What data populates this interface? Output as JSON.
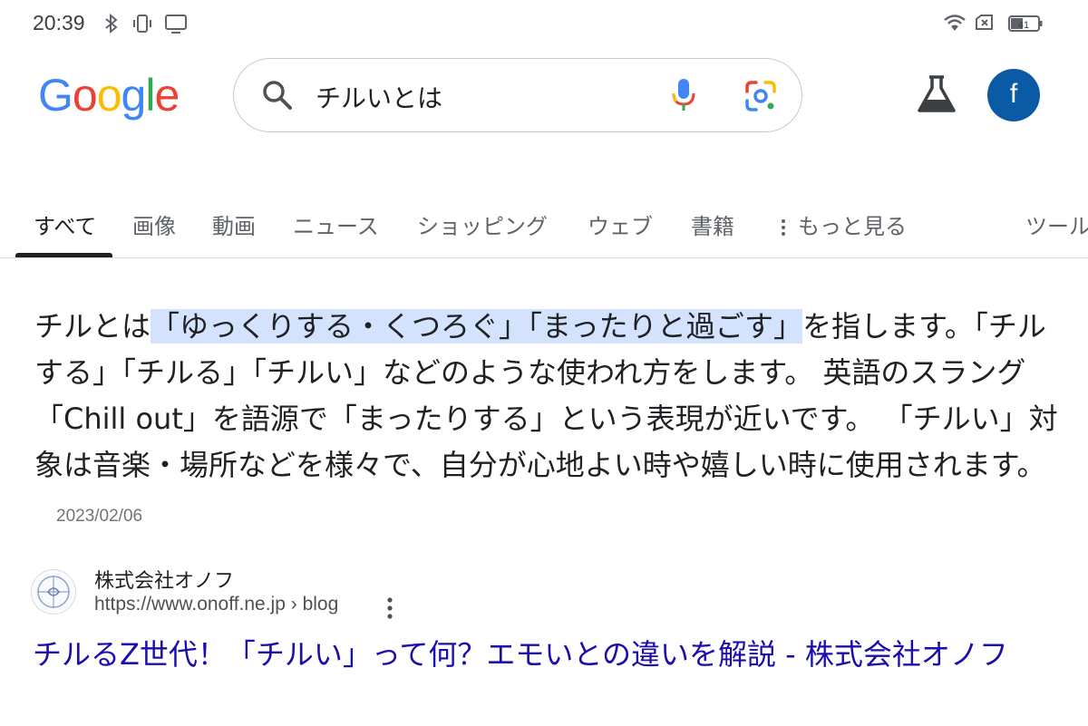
{
  "status_bar": {
    "time": "20:39",
    "battery": "41",
    "icons": [
      "bluetooth-icon",
      "vibrate-icon",
      "cast-icon",
      "wifi-icon",
      "no-sim-icon",
      "battery-icon"
    ]
  },
  "logo": {
    "letters": [
      "G",
      "o",
      "o",
      "g",
      "l",
      "e"
    ],
    "colors": [
      "#4285F4",
      "#EA4335",
      "#FBBC05",
      "#4285F4",
      "#34A853",
      "#EA4335"
    ]
  },
  "search": {
    "query": "チルいとは"
  },
  "account": {
    "initial": "f",
    "color": "#0b5aa6"
  },
  "tabs": {
    "items": [
      {
        "label": "すべて",
        "active": true
      },
      {
        "label": "画像"
      },
      {
        "label": "動画"
      },
      {
        "label": "ニュース"
      },
      {
        "label": "ショッピング"
      },
      {
        "label": "ウェブ"
      },
      {
        "label": "書籍"
      },
      {
        "label": "もっと見る"
      },
      {
        "label": "ツール"
      }
    ]
  },
  "answer": {
    "prefix": "チルとは",
    "highlight": "「ゆっくりする・くつろぐ」「まったりと過ごす」",
    "body": "を指します。「チルする」「チルる」「チルい」などのような使われ方をします。 英語のスラング「Chill out」を語源で「まったりする」という表現が近いです。 「チルい」対象は音楽・場所などを様々で、自分が心地よい時や嬉しい時に使用されます。",
    "date": "2023/02/06",
    "highlight_color": "#d3e3fd"
  },
  "result": {
    "site_name": "株式会社オノフ",
    "url": "https://www.onoff.ne.jp › blog",
    "title": "チルるZ世代！「チルい」って何？エモいとの違いを解説 - 株式会社オノフ",
    "link_color": "#1a0dab"
  }
}
